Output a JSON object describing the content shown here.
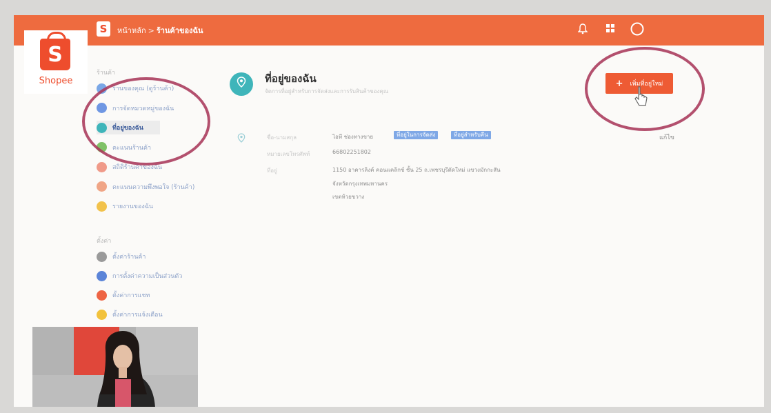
{
  "app": {
    "logo_text": "Shopee",
    "logo_glyph": "S"
  },
  "header": {
    "breadcrumb_home": "หน้าหลัก",
    "breadcrumb_separator": ">",
    "breadcrumb_current": "ร้านค้าของฉัน",
    "icons": [
      "bell-icon",
      "grid-icon",
      "avatar"
    ]
  },
  "sidebar": {
    "section1_label": "ร้านค้า",
    "section1_items": [
      {
        "label": "ร้านของคุณ (ดูร้านค้า)",
        "color": "#7aa7e6"
      },
      {
        "label": "การจัดหมวดหมู่ของฉัน",
        "color": "#6f97e3"
      },
      {
        "label": "ที่อยู่ของฉัน",
        "color": "#3fb5ba"
      },
      {
        "label": "คะแนนร้านค้า",
        "color": "#80c267"
      },
      {
        "label": "สถิติร้านค้าของฉัน",
        "color": "#f09a89"
      },
      {
        "label": "คะแนนความพึงพอใจ (ร้านค้า)",
        "color": "#f0a586"
      },
      {
        "label": "รายงานของฉัน",
        "color": "#f2c24b"
      }
    ],
    "section2_label": "ตั้งค่า",
    "section2_items": [
      {
        "label": "ตั้งค่าร้านค้า",
        "color": "#9a9a9a"
      },
      {
        "label": "การตั้งค่าความเป็นส่วนตัว",
        "color": "#5b84d8"
      },
      {
        "label": "ตั้งค่าการแชท",
        "color": "#ee6444"
      },
      {
        "label": "ตั้งค่าการแจ้งเตือน",
        "color": "#f2c23c"
      }
    ]
  },
  "main": {
    "title": "ที่อยู่ของฉัน",
    "subtitle": "จัดการที่อยู่สำหรับการจัดส่งและการรับสินค้าของคุณ",
    "add_button_label": "เพิ่มที่อยู่ใหม่",
    "add_button_icon": "plus-icon",
    "address": {
      "name_label": "ชื่อ-นามสกุล",
      "name_value": "ไอที ช่องทางขาย",
      "badges": [
        "ที่อยู่ในการจัดส่ง",
        "ที่อยู่สำหรับคืน"
      ],
      "phone_label": "หมายเลขโทรศัพท์",
      "phone_value": "66802251802",
      "address_label": "ที่อยู่",
      "address_lines": [
        "1150 อาคารลิงค์ คอนแคลิกซ์ ชั้น 25 ถ.เพชรบุรีตัดใหม่ แขวงมักกะสัน",
        "จังหวัดกรุงเทพมหานคร",
        "เขตห้วยขวาง"
      ],
      "edit_label": "แก้ไข"
    }
  },
  "colors": {
    "brand": "#ee4d2d",
    "topbar": "#ee6b3f",
    "annotation_circle": "#a8385a"
  }
}
